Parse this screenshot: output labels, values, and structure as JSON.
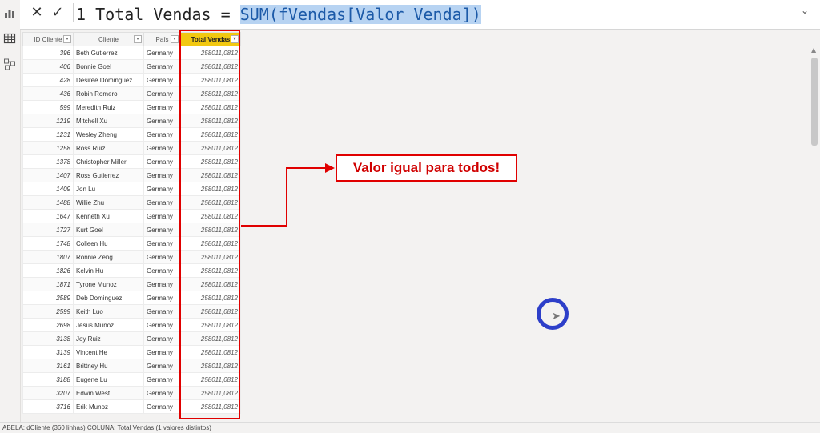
{
  "formula_bar": {
    "cancel_icon": "close-icon",
    "confirm_icon": "check-icon",
    "cancel_glyph": "✕",
    "confirm_glyph": "✓",
    "line_number": "1",
    "formula_prefix": "Total Vendas = ",
    "formula_selected": "SUM(fVendas[Valor Venda])",
    "expand_glyph": "⌄"
  },
  "left_rail": {
    "icons": [
      "report-view-icon",
      "data-view-icon",
      "model-view-icon"
    ]
  },
  "table": {
    "columns": [
      "ID Cliente",
      "Cliente",
      "País",
      "Total Vendas"
    ],
    "filter_glyph": "▾",
    "rows": [
      [
        "396",
        "Beth Gutierrez",
        "Germany",
        "258011,0812"
      ],
      [
        "406",
        "Bonnie Goel",
        "Germany",
        "258011,0812"
      ],
      [
        "428",
        "Desiree Dominguez",
        "Germany",
        "258011,0812"
      ],
      [
        "436",
        "Robin Romero",
        "Germany",
        "258011,0812"
      ],
      [
        "599",
        "Meredith Ruiz",
        "Germany",
        "258011,0812"
      ],
      [
        "1219",
        "Mitchell Xu",
        "Germany",
        "258011,0812"
      ],
      [
        "1231",
        "Wesley Zheng",
        "Germany",
        "258011,0812"
      ],
      [
        "1258",
        "Ross Ruiz",
        "Germany",
        "258011,0812"
      ],
      [
        "1378",
        "Christopher Miller",
        "Germany",
        "258011,0812"
      ],
      [
        "1407",
        "Ross Gutierrez",
        "Germany",
        "258011,0812"
      ],
      [
        "1409",
        "Jon Lu",
        "Germany",
        "258011,0812"
      ],
      [
        "1488",
        "Willie Zhu",
        "Germany",
        "258011,0812"
      ],
      [
        "1647",
        "Kenneth Xu",
        "Germany",
        "258011,0812"
      ],
      [
        "1727",
        "Kurt Goel",
        "Germany",
        "258011,0812"
      ],
      [
        "1748",
        "Colleen Hu",
        "Germany",
        "258011,0812"
      ],
      [
        "1807",
        "Ronnie Zeng",
        "Germany",
        "258011,0812"
      ],
      [
        "1826",
        "Kelvin Hu",
        "Germany",
        "258011,0812"
      ],
      [
        "1871",
        "Tyrone Munoz",
        "Germany",
        "258011,0812"
      ],
      [
        "2589",
        "Deb Dominguez",
        "Germany",
        "258011,0812"
      ],
      [
        "2599",
        "Keith Luo",
        "Germany",
        "258011,0812"
      ],
      [
        "2698",
        "Jésus Munoz",
        "Germany",
        "258011,0812"
      ],
      [
        "3138",
        "Joy Ruiz",
        "Germany",
        "258011,0812"
      ],
      [
        "3139",
        "Vincent He",
        "Germany",
        "258011,0812"
      ],
      [
        "3161",
        "Brittney Hu",
        "Germany",
        "258011,0812"
      ],
      [
        "3188",
        "Eugene Lu",
        "Germany",
        "258011,0812"
      ],
      [
        "3207",
        "Edwin West",
        "Germany",
        "258011,0812"
      ],
      [
        "3716",
        "Erik Munoz",
        "Germany",
        "258011,0812"
      ]
    ]
  },
  "annotation": {
    "text": "Valor igual para todos!",
    "color": "#e00000"
  },
  "highlight_color": "#f2c811",
  "status_bar": {
    "text": "ABELA: dCliente (360 linhas) COLUNA: Total Vendas (1 valores distintos)"
  }
}
